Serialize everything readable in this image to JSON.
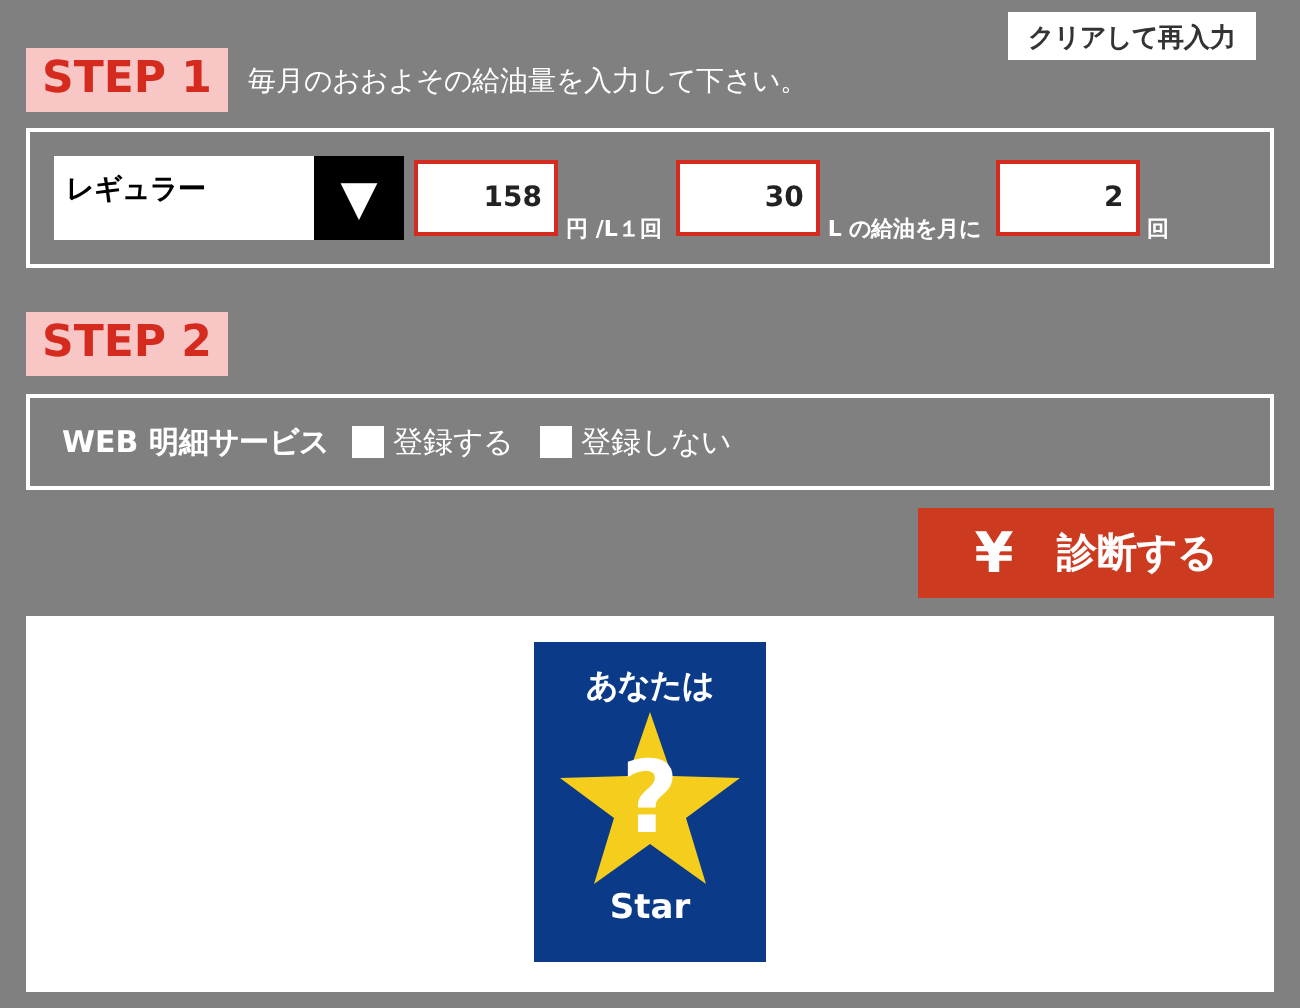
{
  "clear_button": "クリアして再入力",
  "step1": {
    "badge": "STEP 1",
    "instruction": "毎月のおおよその給油量を入力して下さい。",
    "fuel_select": {
      "value": "レギュラー",
      "arrow": "▼"
    },
    "fields": [
      {
        "value": "158",
        "unit": "円 /L１回"
      },
      {
        "value": "30",
        "unit": "L の給油を月に"
      },
      {
        "value": "2",
        "unit": "回"
      }
    ]
  },
  "step2": {
    "badge": "STEP 2",
    "label": "WEB 明細サービス",
    "options": [
      {
        "label": "登録する",
        "checked": false
      },
      {
        "label": "登録しない",
        "checked": false
      }
    ]
  },
  "diagnose_button": {
    "icon": "¥",
    "label": "診断する"
  },
  "result_card": {
    "heading": "あなたは",
    "mark": "?",
    "caption": "Star"
  }
}
